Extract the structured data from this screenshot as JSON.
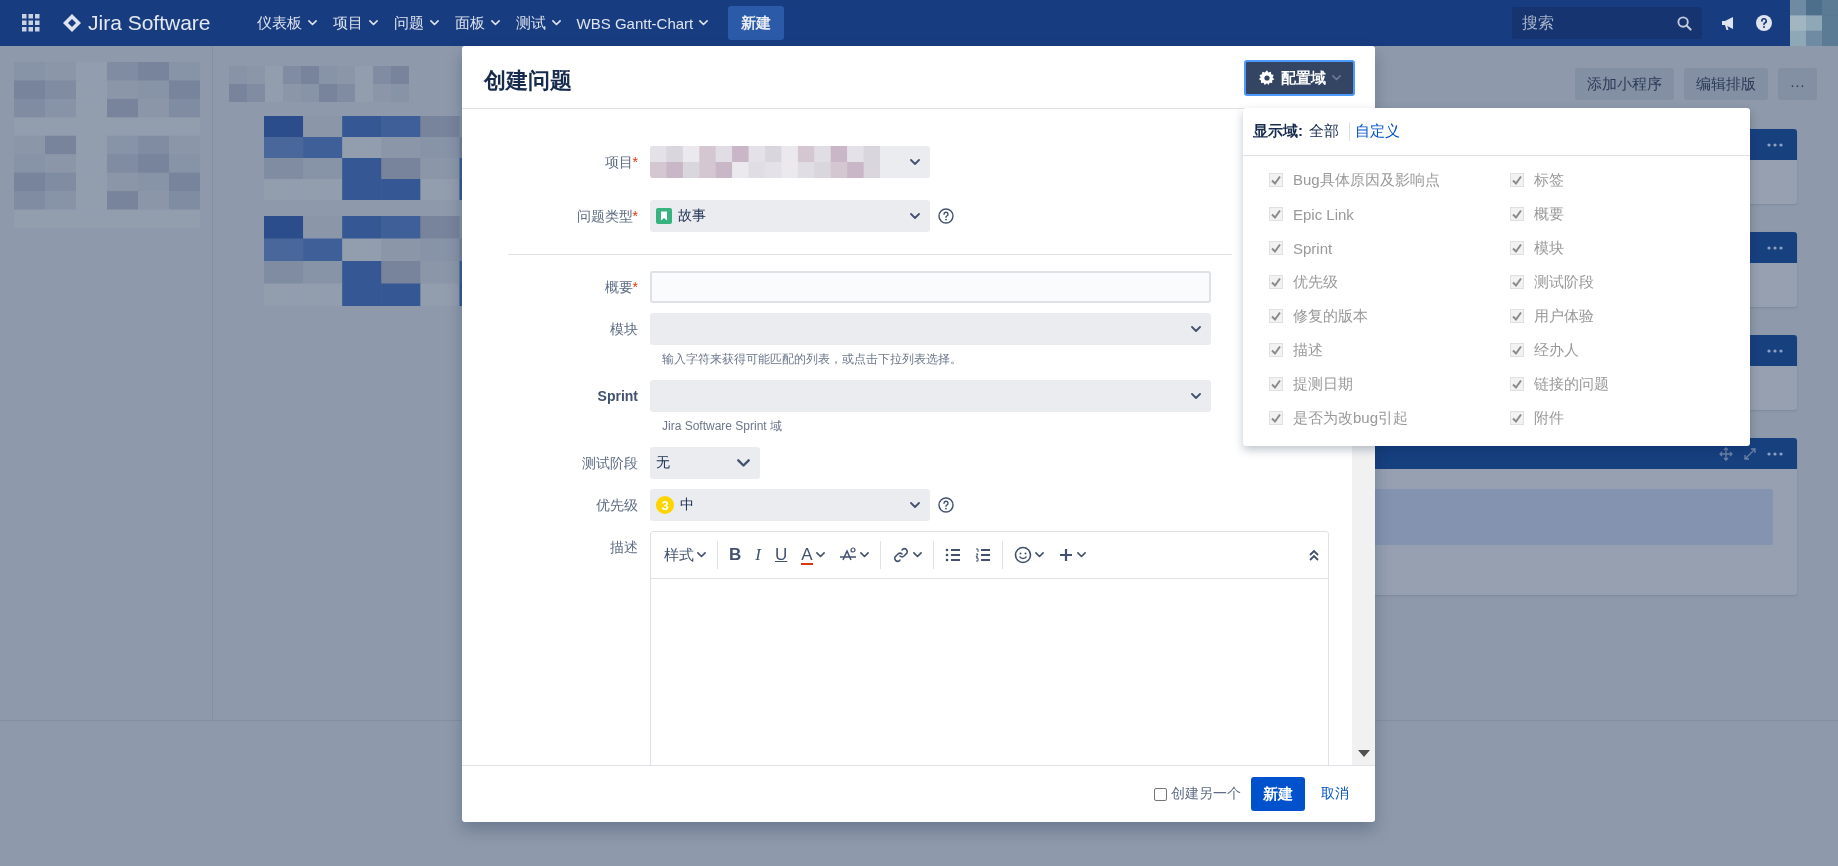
{
  "nav": {
    "logo": "Jira Software",
    "menus": [
      {
        "label": "仪表板",
        "dropdown": true
      },
      {
        "label": "项目",
        "dropdown": true
      },
      {
        "label": "问题",
        "dropdown": true
      },
      {
        "label": "面板",
        "dropdown": true
      },
      {
        "label": "测试",
        "dropdown": true
      },
      {
        "label": "WBS Gantt-Chart",
        "dropdown": true
      }
    ],
    "create_button": "新建",
    "search": {
      "placeholder": "搜索"
    }
  },
  "dashboard": {
    "buttons": [
      "添加小程序",
      "编辑排版",
      "···"
    ]
  },
  "dialog": {
    "title": "创建问题",
    "config_button": "配置域",
    "top_fields": [
      {
        "kind": "redacted-select",
        "label": "项目",
        "required_mark": "*",
        "help": false
      },
      {
        "kind": "select",
        "label": "问题类型",
        "required_mark": "*",
        "value": "故事",
        "help": true
      }
    ],
    "fields": [
      {
        "kind": "input",
        "label": "概要",
        "required_mark": "*",
        "bold": false
      },
      {
        "kind": "select",
        "label": "模块",
        "bold": false,
        "hint": "输入字符来获得可能匹配的列表，或点击下拉列表选择。"
      },
      {
        "kind": "select",
        "label": "Sprint",
        "bold": true,
        "hint": "Jira Software Sprint 域"
      },
      {
        "kind": "select",
        "label": "测试阶段",
        "bold": false,
        "value": "无"
      },
      {
        "kind": "select",
        "label": "优先级",
        "bold": false,
        "badge": "3",
        "value": "中",
        "help": true
      },
      {
        "kind": "editor",
        "label": "描述",
        "bold": false
      }
    ],
    "toolbar": [
      {
        "items": [
          {
            "kind": "text",
            "label": "样式",
            "menu": true
          }
        ]
      },
      {
        "items": [
          {
            "kind": "bold",
            "label": "B",
            "menu": false
          },
          {
            "kind": "italic",
            "label": "I",
            "menu": false
          },
          {
            "kind": "underline",
            "label": "U",
            "menu": false
          },
          {
            "kind": "color",
            "label": "A",
            "menu": true
          },
          {
            "kind": "effects",
            "menu": true
          }
        ]
      },
      {
        "items": [
          {
            "kind": "link",
            "menu": true
          }
        ]
      },
      {
        "items": [
          {
            "kind": "bullets",
            "menu": false
          },
          {
            "kind": "numbers",
            "menu": false
          }
        ]
      },
      {
        "items": [
          {
            "kind": "emoji",
            "menu": true
          },
          {
            "kind": "insert",
            "menu": true
          }
        ]
      }
    ],
    "create_another": {
      "label": "创建另一个",
      "checked": false
    },
    "submit": "新建",
    "cancel": "取消"
  },
  "field_popup": {
    "label": "显示域:",
    "options": [
      {
        "label": "全部",
        "selected": true
      },
      {
        "label": "自定义",
        "selected": false
      }
    ],
    "fields": [
      {
        "label": "Bug具体原因及影响点",
        "checked": true
      },
      {
        "label": "Epic Link",
        "checked": true
      },
      {
        "label": "Sprint",
        "checked": true
      },
      {
        "label": "优先级",
        "checked": true
      },
      {
        "label": "修复的版本",
        "checked": true
      },
      {
        "label": "描述",
        "checked": true
      },
      {
        "label": "提测日期",
        "checked": true
      },
      {
        "label": "是否为改bug引起",
        "checked": true
      },
      {
        "label": "标签",
        "checked": true
      },
      {
        "label": "概要",
        "checked": true
      },
      {
        "label": "模块",
        "checked": true
      },
      {
        "label": "测试阶段",
        "checked": true
      },
      {
        "label": "用户体验",
        "checked": true
      },
      {
        "label": "经办人",
        "checked": true
      },
      {
        "label": "链接的问题",
        "checked": true
      },
      {
        "label": "附件",
        "checked": true
      }
    ]
  }
}
